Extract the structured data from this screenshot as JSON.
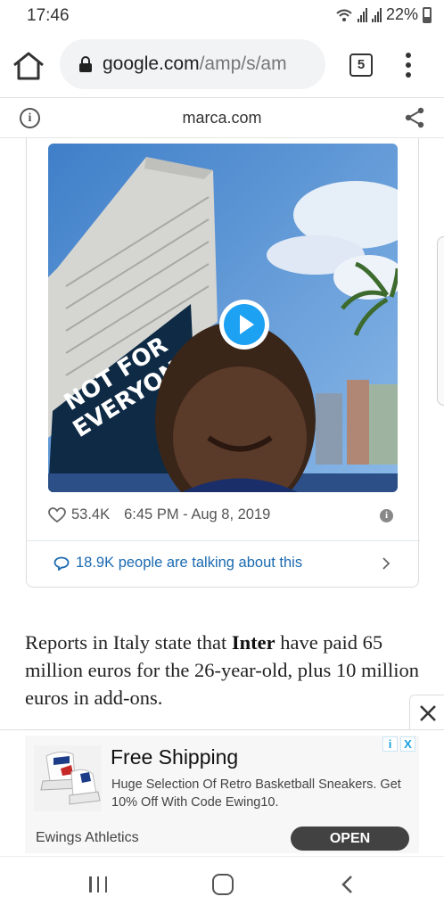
{
  "status_bar": {
    "time": "17:46",
    "battery": "22%"
  },
  "browser": {
    "url_domain": "google.com",
    "url_path": "/amp/s/am",
    "tab_count": "5"
  },
  "amp_header": {
    "domain": "marca.com"
  },
  "tweet": {
    "likes": "53.4K",
    "timestamp": "6:45 PM - Aug 8, 2019",
    "talking": "18.9K people are talking about this",
    "media_text_line1": "NOT FOR",
    "media_text_line2": "EVERYONE"
  },
  "article": {
    "text_before": "Reports in Italy state that ",
    "text_bold": "Inter",
    "text_after": " have paid 65 million euros for the 26-year-old, plus 10 million euros in add-ons."
  },
  "ad": {
    "title": "Free Shipping",
    "description": "Huge Selection Of Retro Basketball Sneakers. Get 10% Off With Code Ewing10.",
    "advertiser": "Ewings Athletics",
    "cta": "OPEN",
    "info_badge": "i",
    "close_badge": "X"
  },
  "colors": {
    "twitter_blue": "#1da1f2",
    "link_blue": "#1b6ab1",
    "cta_dark": "#424242"
  },
  "icons": [
    "wifi-icon",
    "signal-icon",
    "battery-icon",
    "home-icon",
    "lock-icon",
    "tabs-icon",
    "menu-icon",
    "info-icon",
    "share-icon",
    "play-icon",
    "heart-icon",
    "speech-bubble-icon",
    "chevron-right-icon",
    "close-icon",
    "recents-icon",
    "home-nav-icon",
    "back-icon"
  ]
}
